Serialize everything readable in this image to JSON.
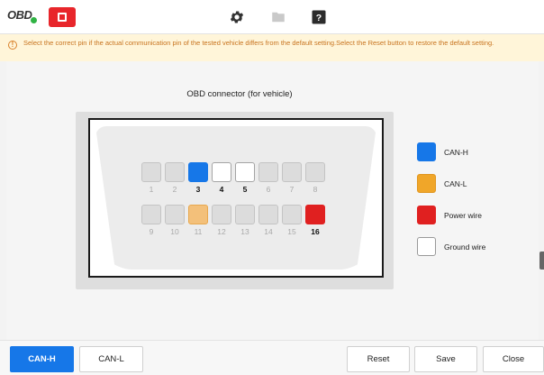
{
  "topbar": {
    "logo_text": "OBD",
    "icons": [
      "stop-icon",
      "gear-icon",
      "folder-icon",
      "help-icon"
    ]
  },
  "notice": {
    "icon": "info-icon",
    "text": "Select the correct pin if the actual communication pin of the tested vehicle differs from the default setting.Select the Reset button to restore the default setting."
  },
  "connector": {
    "title": "OBD connector (for vehicle)",
    "pins": [
      {
        "number": "1",
        "state": "none"
      },
      {
        "number": "2",
        "state": "none"
      },
      {
        "number": "3",
        "state": "CAN-H"
      },
      {
        "number": "4",
        "state": "Ground wire"
      },
      {
        "number": "5",
        "state": "Ground wire"
      },
      {
        "number": "6",
        "state": "none"
      },
      {
        "number": "7",
        "state": "none"
      },
      {
        "number": "8",
        "state": "none"
      },
      {
        "number": "9",
        "state": "none"
      },
      {
        "number": "10",
        "state": "none"
      },
      {
        "number": "11",
        "state": "CAN-L"
      },
      {
        "number": "12",
        "state": "none"
      },
      {
        "number": "13",
        "state": "none"
      },
      {
        "number": "14",
        "state": "none"
      },
      {
        "number": "15",
        "state": "none"
      },
      {
        "number": "16",
        "state": "Power wire"
      }
    ]
  },
  "legend": [
    {
      "label": "CAN-H",
      "color": "#1677e8"
    },
    {
      "label": "CAN-L",
      "color": "#f0a629"
    },
    {
      "label": "Power wire",
      "color": "#e02020"
    },
    {
      "label": "Ground wire",
      "color": "#ffffff"
    }
  ],
  "bottombar": {
    "tab_can_h": "CAN-H",
    "tab_can_l": "CAN-L",
    "reset": "Reset",
    "save": "Save",
    "close": "Close",
    "active_tab": "CAN-H"
  }
}
